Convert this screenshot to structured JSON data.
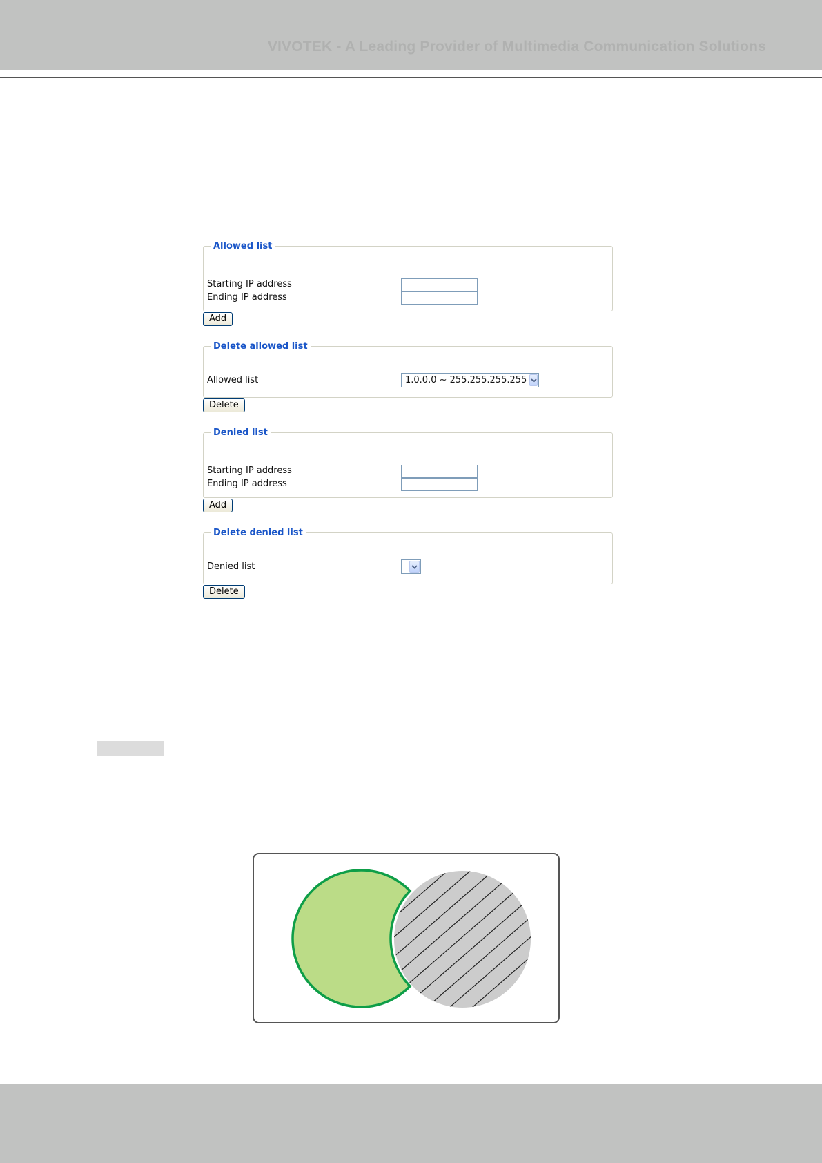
{
  "header": {
    "tagline": "VIVOTEK - A Leading Provider of Multimedia Communication Solutions"
  },
  "panels": {
    "allowed": {
      "legend": "Allowed list",
      "starting_label": "Starting IP address",
      "ending_label": "Ending IP address",
      "starting_value": "",
      "ending_value": "",
      "button_label": "Add"
    },
    "delete_allowed": {
      "legend": "Delete allowed list",
      "field_label": "Allowed list",
      "selected_value": "1.0.0.0 ~ 255.255.255.255",
      "button_label": "Delete"
    },
    "denied": {
      "legend": "Denied list",
      "starting_label": "Starting IP address",
      "ending_label": "Ending IP address",
      "starting_value": "",
      "ending_value": "",
      "button_label": "Add"
    },
    "delete_denied": {
      "legend": "Delete denied list",
      "field_label": "Denied list",
      "selected_value": "",
      "button_label": "Delete"
    }
  },
  "diagram": {
    "allowed_fill": "#bbdc87",
    "allowed_stroke": "#0e9e48",
    "denied_fill": "#cccccc",
    "hatch_color": "#222222"
  },
  "theme": {
    "band_color": "#c1c2c1",
    "legend_color": "#1a56c8"
  }
}
